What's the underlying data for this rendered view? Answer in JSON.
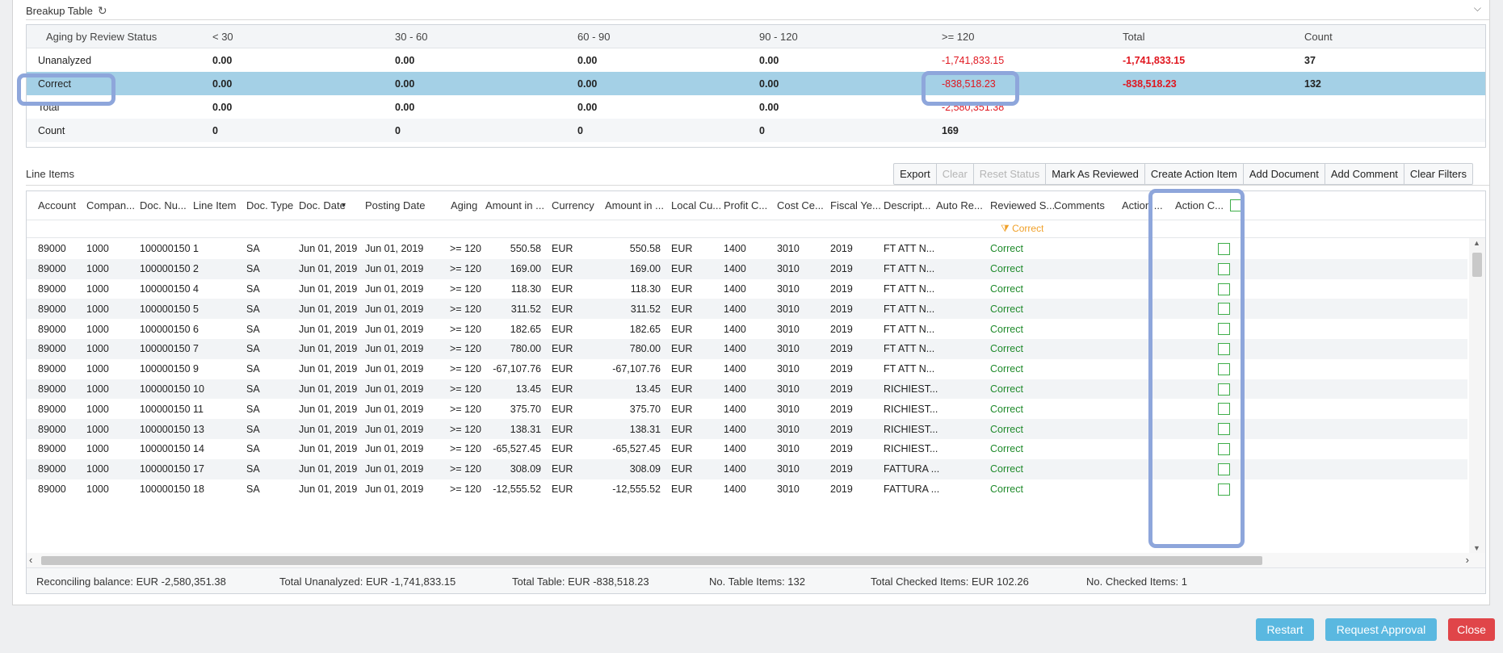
{
  "breakup": {
    "title": "Breakup Table",
    "columns": [
      "Aging by Review Status",
      "< 30",
      "30 - 60",
      "60 - 90",
      "90 - 120",
      ">= 120",
      "Total",
      "Count"
    ],
    "rows": [
      {
        "label": "Unanalyzed",
        "v": [
          "0.00",
          "0.00",
          "0.00",
          "0.00",
          "-1,741,833.15",
          "-1,741,833.15",
          "37"
        ]
      },
      {
        "label": "Correct",
        "v": [
          "0.00",
          "0.00",
          "0.00",
          "0.00",
          "-838,518.23",
          "-838,518.23",
          "132"
        ]
      },
      {
        "label": "Total",
        "v": [
          "0.00",
          "0.00",
          "0.00",
          "0.00",
          "-2,580,351.38",
          "",
          ""
        ]
      },
      {
        "label": "Count",
        "v": [
          "0",
          "0",
          "0",
          "0",
          "169",
          "",
          ""
        ]
      }
    ]
  },
  "line_items": {
    "title": "Line Items",
    "toolbar": [
      "Export",
      "Clear",
      "Reset Status",
      "Mark As Reviewed",
      "Create Action Item",
      "Add Document",
      "Add Comment",
      "Clear Filters"
    ],
    "columns": [
      "Account",
      "Compan...",
      "Doc. Nu...",
      "Line Item",
      "Doc. Type",
      "Doc. Date",
      "Posting Date",
      "Aging",
      "Amount in ...",
      "Currency",
      "Amount in ...",
      "Local Cu...",
      "Profit C...",
      "Cost Ce...",
      "Fiscal Ye...",
      "Descript...",
      "Auto Re...",
      "Reviewed S...",
      "Comments",
      "Action ...",
      "Action C..."
    ],
    "filter_value": "Correct",
    "rows": [
      [
        "89000",
        "1000",
        "100000150",
        "1",
        "SA",
        "Jun 01, 2019",
        "Jun 01, 2019",
        ">= 120",
        "550.58",
        "EUR",
        "550.58",
        "EUR",
        "1400",
        "3010",
        "2019",
        "FT ATT N...",
        "Correct"
      ],
      [
        "89000",
        "1000",
        "100000150",
        "2",
        "SA",
        "Jun 01, 2019",
        "Jun 01, 2019",
        ">= 120",
        "169.00",
        "EUR",
        "169.00",
        "EUR",
        "1400",
        "3010",
        "2019",
        "FT ATT N...",
        "Correct"
      ],
      [
        "89000",
        "1000",
        "100000150",
        "4",
        "SA",
        "Jun 01, 2019",
        "Jun 01, 2019",
        ">= 120",
        "118.30",
        "EUR",
        "118.30",
        "EUR",
        "1400",
        "3010",
        "2019",
        "FT ATT N...",
        "Correct"
      ],
      [
        "89000",
        "1000",
        "100000150",
        "5",
        "SA",
        "Jun 01, 2019",
        "Jun 01, 2019",
        ">= 120",
        "311.52",
        "EUR",
        "311.52",
        "EUR",
        "1400",
        "3010",
        "2019",
        "FT ATT N...",
        "Correct"
      ],
      [
        "89000",
        "1000",
        "100000150",
        "6",
        "SA",
        "Jun 01, 2019",
        "Jun 01, 2019",
        ">= 120",
        "182.65",
        "EUR",
        "182.65",
        "EUR",
        "1400",
        "3010",
        "2019",
        "FT ATT N...",
        "Correct"
      ],
      [
        "89000",
        "1000",
        "100000150",
        "7",
        "SA",
        "Jun 01, 2019",
        "Jun 01, 2019",
        ">= 120",
        "780.00",
        "EUR",
        "780.00",
        "EUR",
        "1400",
        "3010",
        "2019",
        "FT ATT N...",
        "Correct"
      ],
      [
        "89000",
        "1000",
        "100000150",
        "9",
        "SA",
        "Jun 01, 2019",
        "Jun 01, 2019",
        ">= 120",
        "-67,107.76",
        "EUR",
        "-67,107.76",
        "EUR",
        "1400",
        "3010",
        "2019",
        "FT ATT N...",
        "Correct"
      ],
      [
        "89000",
        "1000",
        "100000150",
        "10",
        "SA",
        "Jun 01, 2019",
        "Jun 01, 2019",
        ">= 120",
        "13.45",
        "EUR",
        "13.45",
        "EUR",
        "1400",
        "3010",
        "2019",
        "RICHIEST...",
        "Correct"
      ],
      [
        "89000",
        "1000",
        "100000150",
        "11",
        "SA",
        "Jun 01, 2019",
        "Jun 01, 2019",
        ">= 120",
        "375.70",
        "EUR",
        "375.70",
        "EUR",
        "1400",
        "3010",
        "2019",
        "RICHIEST...",
        "Correct"
      ],
      [
        "89000",
        "1000",
        "100000150",
        "13",
        "SA",
        "Jun 01, 2019",
        "Jun 01, 2019",
        ">= 120",
        "138.31",
        "EUR",
        "138.31",
        "EUR",
        "1400",
        "3010",
        "2019",
        "RICHIEST...",
        "Correct"
      ],
      [
        "89000",
        "1000",
        "100000150",
        "14",
        "SA",
        "Jun 01, 2019",
        "Jun 01, 2019",
        ">= 120",
        "-65,527.45",
        "EUR",
        "-65,527.45",
        "EUR",
        "1400",
        "3010",
        "2019",
        "RICHIEST...",
        "Correct"
      ],
      [
        "89000",
        "1000",
        "100000150",
        "17",
        "SA",
        "Jun 01, 2019",
        "Jun 01, 2019",
        ">= 120",
        "308.09",
        "EUR",
        "308.09",
        "EUR",
        "1400",
        "3010",
        "2019",
        "FATTURA ...",
        "Correct"
      ],
      [
        "89000",
        "1000",
        "100000150",
        "18",
        "SA",
        "Jun 01, 2019",
        "Jun 01, 2019",
        ">= 120",
        "-12,555.52",
        "EUR",
        "-12,555.52",
        "EUR",
        "1400",
        "3010",
        "2019",
        "FATTURA ...",
        "Correct"
      ]
    ],
    "footer": {
      "reconciling": "Reconciling balance:  EUR -2,580,351.38",
      "unanalyzed": "Total Unanalyzed:  EUR -1,741,833.15",
      "table": "Total Table:  EUR -838,518.23",
      "table_items": "No. Table Items:  132",
      "checked_total": "Total Checked Items:  EUR 102.26",
      "checked_count": "No. Checked Items:  1"
    }
  },
  "actions": {
    "restart": "Restart",
    "request_approval": "Request Approval",
    "close": "Close"
  },
  "colors": {
    "accent_blue": "#5ab8e0",
    "danger": "#e04549",
    "selected_row": "#a4d0e6",
    "negative": "#e0161f",
    "status_green": "#1f8a2b",
    "filter_orange": "#f0a028",
    "highlight": "#8ea6db"
  },
  "icons": {
    "refresh": "refresh-icon",
    "collapse": "chevron-down-icon",
    "filter": "funnel-icon",
    "sort": "sort-down-icon"
  }
}
